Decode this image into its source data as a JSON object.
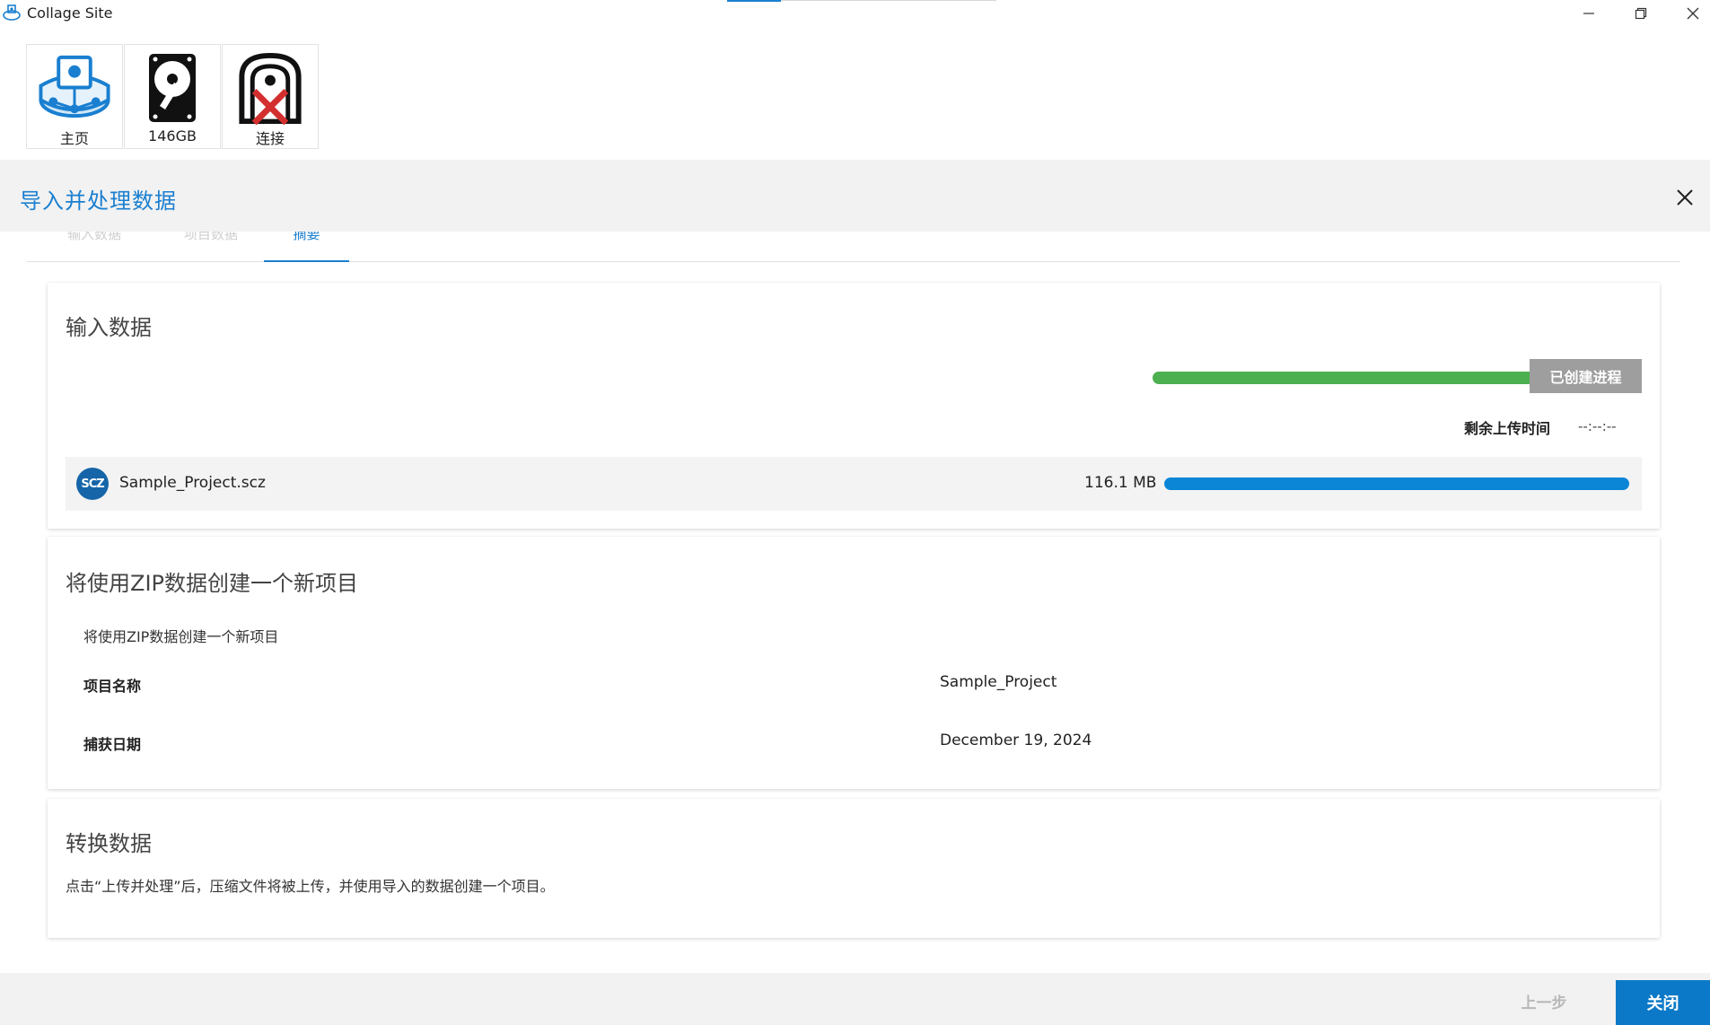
{
  "window": {
    "title": "Collage Site",
    "app_icon": "collage-logo-icon",
    "controls": [
      "minimize-icon",
      "restore-icon",
      "close-icon"
    ]
  },
  "toolbar": {
    "tiles": [
      {
        "label": "主页",
        "icon": "home-network-icon"
      },
      {
        "label": "146GB",
        "icon": "hard-drive-icon"
      },
      {
        "label": "连接",
        "icon": "disconnected-device-icon"
      }
    ]
  },
  "dialog": {
    "title": "导入并处理数据",
    "tabs": [
      {
        "label": "输入数据",
        "active": false
      },
      {
        "label": "项目数据",
        "active": false
      },
      {
        "label": "摘要",
        "active": true
      }
    ]
  },
  "input_card": {
    "title": "输入数据",
    "overall_progress": 1.0,
    "status": "已创建进程",
    "remaining_label": "剩余上传时间",
    "remaining_value": "--:--:--",
    "file": {
      "icon_text": "SCZ",
      "name": "Sample_Project.scz",
      "size": "116.1 MB",
      "progress": 1.0
    }
  },
  "project_card": {
    "title": "将使用ZIP数据创建一个新项目",
    "description": "将使用ZIP数据创建一个新项目",
    "rows": [
      {
        "label": "项目名称",
        "value": "Sample_Project"
      },
      {
        "label": "捕获日期",
        "value": "December 19, 2024"
      }
    ]
  },
  "convert_card": {
    "title": "转换数据",
    "description": "点击“上传并处理”后，压缩文件将被上传，并使用导入的数据创建一个项目。"
  },
  "footer": {
    "prev_label": "上一步",
    "close_label": "关闭"
  },
  "colors": {
    "accent": "#1a7fd0",
    "progress_green": "#4caf50",
    "progress_blue": "#0b86d6",
    "badge_gray": "#9e9e9e"
  }
}
